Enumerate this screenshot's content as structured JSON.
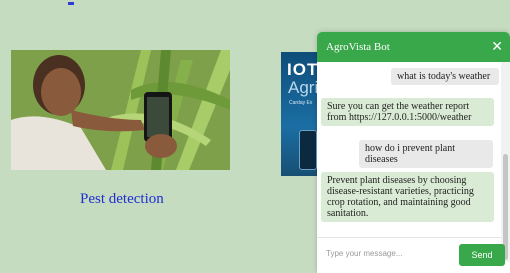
{
  "page": {
    "caption": "Pest detection"
  },
  "iot_card": {
    "title": "IOT",
    "subtitle": "Agri",
    "tiny": "Carday Ex"
  },
  "chat": {
    "title": "AgroVista Bot",
    "close_glyph": "✕",
    "messages": [
      {
        "role": "user",
        "text": "what is today's weather"
      },
      {
        "role": "bot",
        "text": "Sure you can get the weather report from https://127.0.0.1:5000/weather"
      },
      {
        "role": "user",
        "text": "how do i prevent plant diseases"
      },
      {
        "role": "bot",
        "text": "Prevent plant diseases by choosing disease-resistant varieties, practicing crop rotation, and maintaining good sanitation."
      }
    ],
    "input_placeholder": "Type your message...",
    "send_label": "Send"
  },
  "colors": {
    "background": "#c6dcc0",
    "accent": "#39a84a",
    "link": "#1f2fd0"
  }
}
